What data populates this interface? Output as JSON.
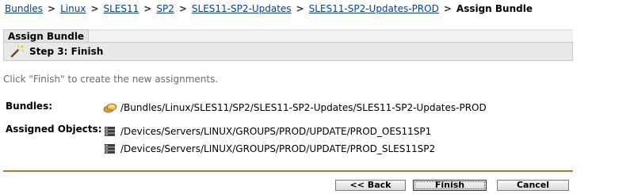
{
  "breadcrumb": {
    "links": [
      "Bundles",
      "Linux",
      "SLES11",
      "SP2",
      "SLES11-SP2-Updates",
      "SLES11-SP2-Updates-PROD"
    ],
    "separator": ">",
    "current": "Assign Bundle"
  },
  "panel": {
    "tab_title": "Assign Bundle",
    "step_icon": "wizard-wand-icon",
    "step_title": "Step 3: Finish"
  },
  "instructions": "Click \"Finish\" to create the new assignments.",
  "bundles": {
    "label": "Bundles:",
    "icon": "bundle-icon",
    "path": "/Bundles/Linux/SLES11/SP2/SLES11-SP2-Updates/SLES11-SP2-Updates-PROD"
  },
  "assigned_objects": {
    "label": "Assigned Objects:",
    "icon": "server-group-icon",
    "items": [
      "/Devices/Servers/LINUX/GROUPS/PROD/UPDATE/PROD_OES11SP1",
      "/Devices/Servers/LINUX/GROUPS/PROD/UPDATE/PROD_SLES11SP2"
    ]
  },
  "colors": {
    "link": "#0b3f8f",
    "divider": "#b8743a",
    "panel_bg": "#e9e9e9"
  },
  "buttons": {
    "back": "<< Back",
    "finish": "Finish",
    "cancel": "Cancel"
  }
}
